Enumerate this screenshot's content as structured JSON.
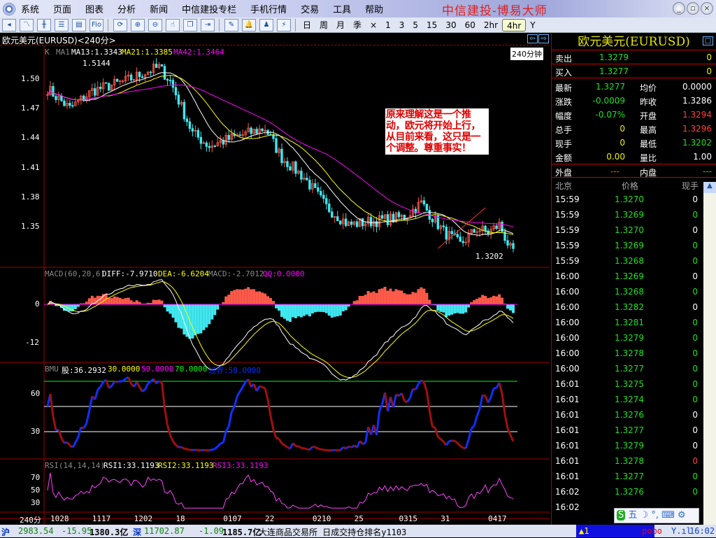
{
  "menu": [
    "系统",
    "页面",
    "图表",
    "分析",
    "新闻",
    "中信建投专栏",
    "手机行情",
    "交易",
    "工具",
    "帮助"
  ],
  "brand": "中信建投-博易大师",
  "toolbar_icons": [
    "back-icon",
    "line-chart-icon",
    "candle-chart-icon",
    "table-icon",
    "report-icon",
    "f10-icon",
    "refresh-icon",
    "zoom-in-icon",
    "zoom-out-icon",
    "cursor-icon",
    "window-icon",
    "export-icon",
    "draw-icon",
    "alarm-bell-icon",
    "users-icon",
    "lightning-icon"
  ],
  "periods": [
    "日",
    "周",
    "月",
    "季",
    "×",
    "1",
    "3",
    "5",
    "15",
    "30",
    "60",
    "2hr",
    "4hr",
    "Y"
  ],
  "active_period": "4hr",
  "chart": {
    "title": "欧元美元(EURUSD)<240分>",
    "timeframe_badge": "240分钟",
    "ma_legend": {
      "k": "K",
      "ma1": "MA1",
      "ma13": "MA13:1.3343",
      "ma21": "MA21:1.3385",
      "ma42": "MA42:1.3464"
    },
    "high_label": "1.5144",
    "low_label": "1.3202",
    "y_ticks": [
      "1.50",
      "1.47",
      "1.44",
      "1.41",
      "1.38",
      "1.35"
    ],
    "annotation": "原来理解这是一个推动，欧元将开始上行，从目前来看，这只是一个调整。尊重事实！",
    "macd_legend": {
      "name": "MACD(60,20,6)",
      "diff": "DIFF:-7.9710",
      "dea": "DEA:-6.6204",
      "macd": "MACD:-2.7012",
      "qq": "QQ:0.0000"
    },
    "macd_ticks": [
      "0",
      "-12"
    ],
    "bmu_legend": {
      "name": "BMU",
      "gu": "股:36.2932",
      "l30": "30.0000",
      "l50": "50.0000",
      "l70": "70.0000",
      "cross": "过界:50.0000"
    },
    "bmu_ticks": [
      "60",
      "30"
    ],
    "rsi_legend": {
      "name": "RSI(14,14,14)",
      "rsi1": "RSI1:33.1193",
      "rsi2": "RSI2:33.1193",
      "rsi3": "RSI3:33.1193"
    },
    "rsi_ticks": [
      "70",
      "50",
      "30"
    ],
    "x_unit": "240分",
    "x_ticks": [
      "1028",
      "1117",
      "1202",
      "18",
      "0107",
      "22",
      "0210",
      "25",
      "0315",
      "31",
      "0417"
    ]
  },
  "chart_data": {
    "type": "candlestick",
    "candles": 168,
    "price_keypoints": [
      [
        0,
        1.49
      ],
      [
        8,
        1.47
      ],
      [
        16,
        1.488
      ],
      [
        28,
        1.498
      ],
      [
        36,
        1.508
      ],
      [
        40,
        1.512
      ],
      [
        44,
        1.498
      ],
      [
        52,
        1.445
      ],
      [
        58,
        1.432
      ],
      [
        66,
        1.44
      ],
      [
        72,
        1.445
      ],
      [
        78,
        1.45
      ],
      [
        84,
        1.42
      ],
      [
        92,
        1.4
      ],
      [
        100,
        1.37
      ],
      [
        108,
        1.352
      ],
      [
        118,
        1.356
      ],
      [
        128,
        1.36
      ],
      [
        134,
        1.374
      ],
      [
        142,
        1.345
      ],
      [
        148,
        1.332
      ],
      [
        154,
        1.348
      ],
      [
        158,
        1.344
      ],
      [
        162,
        1.352
      ],
      [
        167,
        1.321
      ]
    ],
    "x_tick_indices": [
      3,
      18,
      33,
      48,
      65,
      80,
      97,
      112,
      128,
      143,
      160
    ],
    "ylim": [
      1.32,
      1.52
    ]
  },
  "quote": {
    "title": "欧元美元(EURUSD)",
    "sell": {
      "label": "卖出",
      "price": "1.3279",
      "vol": "0"
    },
    "buy": {
      "label": "买入",
      "price": "1.3277",
      "vol": "0"
    },
    "rows": [
      {
        "l1": "最新",
        "v1": "1.3277",
        "c1": "g",
        "l2": "均价",
        "v2": "0.0000",
        "c2": "w"
      },
      {
        "l1": "涨跌",
        "v1": "-0.0009",
        "c1": "g",
        "l2": "昨收",
        "v2": "1.3286",
        "c2": "w"
      },
      {
        "l1": "幅度",
        "v1": "-0.07%",
        "c1": "g",
        "l2": "开盘",
        "v2": "1.3294",
        "c2": "r"
      },
      {
        "l1": "总手",
        "v1": "0",
        "c1": "y",
        "l2": "最高",
        "v2": "1.3296",
        "c2": "r"
      },
      {
        "l1": "现手",
        "v1": "0",
        "c1": "y",
        "l2": "最低",
        "v2": "1.3202",
        "c2": "g"
      },
      {
        "l1": "金额",
        "v1": "0.00",
        "c1": "y",
        "l2": "量比",
        "v2": "1.00",
        "c2": "w"
      }
    ],
    "outer": {
      "label": "外盘",
      "value": "---"
    },
    "inner": {
      "label": "内盘",
      "value": "---"
    },
    "trade_headers": [
      "北京",
      "价格",
      "现手"
    ],
    "trades": [
      [
        "15:59",
        "1.3270",
        "0",
        "w"
      ],
      [
        "15:59",
        "1.3269",
        "0",
        "g"
      ],
      [
        "15:59",
        "1.3270",
        "0",
        "w"
      ],
      [
        "15:59",
        "1.3269",
        "0",
        "g"
      ],
      [
        "15:59",
        "1.3268",
        "0",
        "g"
      ],
      [
        "16:00",
        "1.3269",
        "0",
        "w"
      ],
      [
        "16:00",
        "1.3268",
        "0",
        "g"
      ],
      [
        "16:00",
        "1.3282",
        "0",
        "w"
      ],
      [
        "16:00",
        "1.3281",
        "0",
        "g"
      ],
      [
        "16:00",
        "1.3279",
        "0",
        "g"
      ],
      [
        "16:00",
        "1.3278",
        "0",
        "g"
      ],
      [
        "16:00",
        "1.3277",
        "0",
        "g"
      ],
      [
        "16:01",
        "1.3275",
        "0",
        "g"
      ],
      [
        "16:01",
        "1.3274",
        "0",
        "g"
      ],
      [
        "16:01",
        "1.3276",
        "0",
        "w"
      ],
      [
        "16:01",
        "1.3277",
        "0",
        "w"
      ],
      [
        "16:01",
        "1.3279",
        "0",
        "w"
      ],
      [
        "16:01",
        "1.3278",
        "0",
        "r"
      ],
      [
        "16:01",
        "1.3277",
        "0",
        "g"
      ],
      [
        "16:02",
        "1.3276",
        "0",
        "g"
      ],
      [
        "16:02",
        "",
        "",
        " w"
      ]
    ]
  },
  "status": {
    "sh_label": "沪",
    "sh_index": "2983.54",
    "sh_change": "-15.95",
    "sh_amount": "1380.3亿",
    "sz_label": "深",
    "sz_index": "11702.87",
    "sz_change": "-1.09",
    "sz_amount": "1185.7亿",
    "news": "大连商品交易所 日成交持仓排名y1103",
    "alert": "1",
    "pobo": "pobo",
    "time": "16:02"
  },
  "ime": "五",
  "colors": {
    "up": "#ff5a4a",
    "down": "#40e8f0",
    "ma13": "#ffffff",
    "ma21": "#ffff00",
    "ma42": "#ff00ff",
    "grid": "#a00000"
  }
}
